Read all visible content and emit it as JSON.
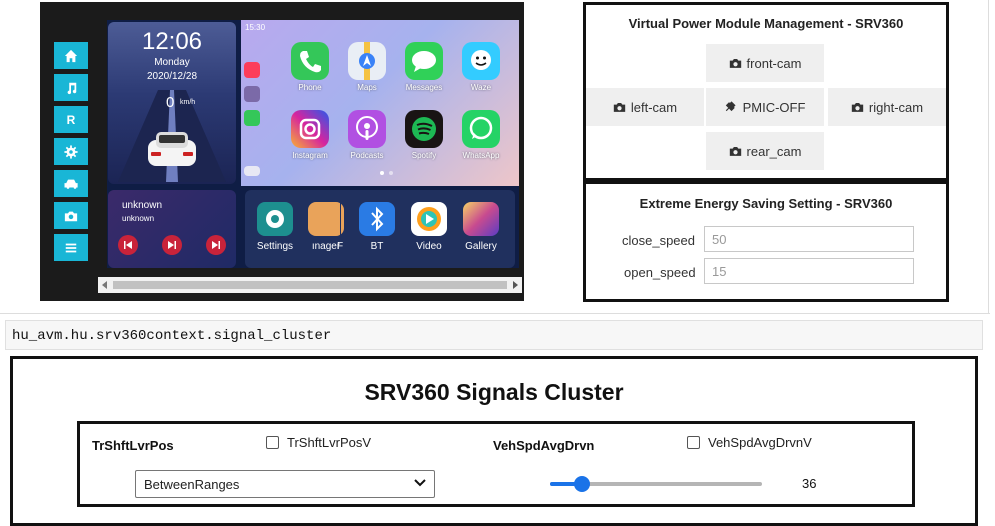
{
  "head_unit": {
    "side_nav": [
      {
        "icon": "home-icon"
      },
      {
        "icon": "music-icon"
      },
      {
        "icon": "r-icon",
        "label": "R"
      },
      {
        "icon": "gear-icon"
      },
      {
        "icon": "car-icon"
      },
      {
        "icon": "camera-icon"
      },
      {
        "icon": "menu-icon"
      }
    ],
    "clock": {
      "time": "12:06",
      "day": "Monday",
      "date": "2020/12/28",
      "speed": "0",
      "speed_unit": "km/h"
    },
    "status_time": "15:30",
    "apps": [
      {
        "label": "Phone",
        "color": "#34c759"
      },
      {
        "label": "Maps",
        "color": "#e9eef5"
      },
      {
        "label": "Messages",
        "color": "#30d158"
      },
      {
        "label": "Waze",
        "color": "#33ccff"
      },
      {
        "label": "Instagram",
        "color": "#d6249f"
      },
      {
        "label": "Podcasts",
        "color": "#b150e2"
      },
      {
        "label": "Spotify",
        "color": "#191414"
      },
      {
        "label": "WhatsApp",
        "color": "#25d366"
      }
    ],
    "media": {
      "title": "unknown",
      "subtitle": "unknown"
    },
    "dock": [
      {
        "label": "Settings",
        "color": "#1d8f8f"
      },
      {
        "label": "ınager",
        "color": "#e9a35a"
      },
      {
        "label": "F",
        "color": "#20305e"
      },
      {
        "label": "BT",
        "color": "#2a7be4"
      },
      {
        "label": "Video",
        "color": "#ffffff"
      },
      {
        "label": "Gallery",
        "color": "#c84b8f"
      }
    ]
  },
  "vpm": {
    "title": "Virtual Power Module Management - SRV360",
    "buttons": {
      "front": "front-cam",
      "left": "left-cam",
      "pmic": "PMIC-OFF",
      "right": "right-cam",
      "rear": "rear_cam"
    }
  },
  "ees": {
    "title": "Extreme Energy Saving Setting - SRV360",
    "close_label": "close_speed",
    "close_value": "50",
    "open_label": "open_speed",
    "open_value": "15"
  },
  "context": {
    "path": "hu_avm.hu.srv360context.signal_cluster"
  },
  "cluster": {
    "title": "SRV360 Signals Cluster",
    "gear": {
      "name": "TrShftLvrPos",
      "check_label": "TrShftLvrPosV",
      "checked": false,
      "selected": "BetweenRanges"
    },
    "speed": {
      "name": "VehSpdAvgDrvn",
      "check_label": "VehSpdAvgDrvnV",
      "checked": false,
      "value": "36",
      "fraction": 0.12
    },
    "accent_color": "#1a73e8"
  }
}
